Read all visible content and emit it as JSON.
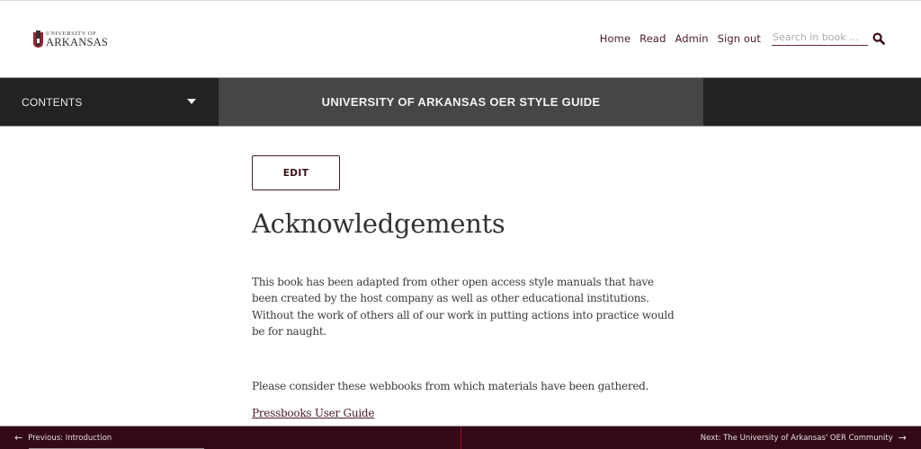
{
  "header": {
    "logo": {
      "line1": "UNIVERSITY OF",
      "line2": "ARKANSAS",
      "icon": "university-shield-icon"
    },
    "nav": [
      {
        "label": "Home"
      },
      {
        "label": "Read"
      },
      {
        "label": "Admin"
      },
      {
        "label": "Sign out"
      }
    ],
    "search": {
      "placeholder": "Search in book …",
      "value": "",
      "icon": "search-icon"
    }
  },
  "bar": {
    "contents_label": "CONTENTS",
    "contents_icon": "caret-down-icon",
    "book_title": "UNIVERSITY OF ARKANSAS OER STYLE GUIDE"
  },
  "main": {
    "edit_label": "EDIT",
    "title": "Acknowledgements",
    "paragraphs": [
      "This book has been adapted from other open access style manuals that have been created by the host company as well as other educational institutions.  Without the work of others all of our work in putting actions into practice would be for naught.",
      "Please consider these webbooks from which materials have been gathered."
    ],
    "links": [
      {
        "label": "Pressbooks User Guide"
      }
    ]
  },
  "footer": {
    "prev_label": "Previous: Introduction",
    "prev_icon": "arrow-left-icon",
    "next_label": "Next: The University of Arkansas' OER Community",
    "next_icon": "arrow-right-icon"
  },
  "colors": {
    "brand": "#4a1c25",
    "footer_bg": "#330818",
    "bar_dark": "#222222",
    "bar_mid": "#464646",
    "shield": "#9d2235"
  }
}
